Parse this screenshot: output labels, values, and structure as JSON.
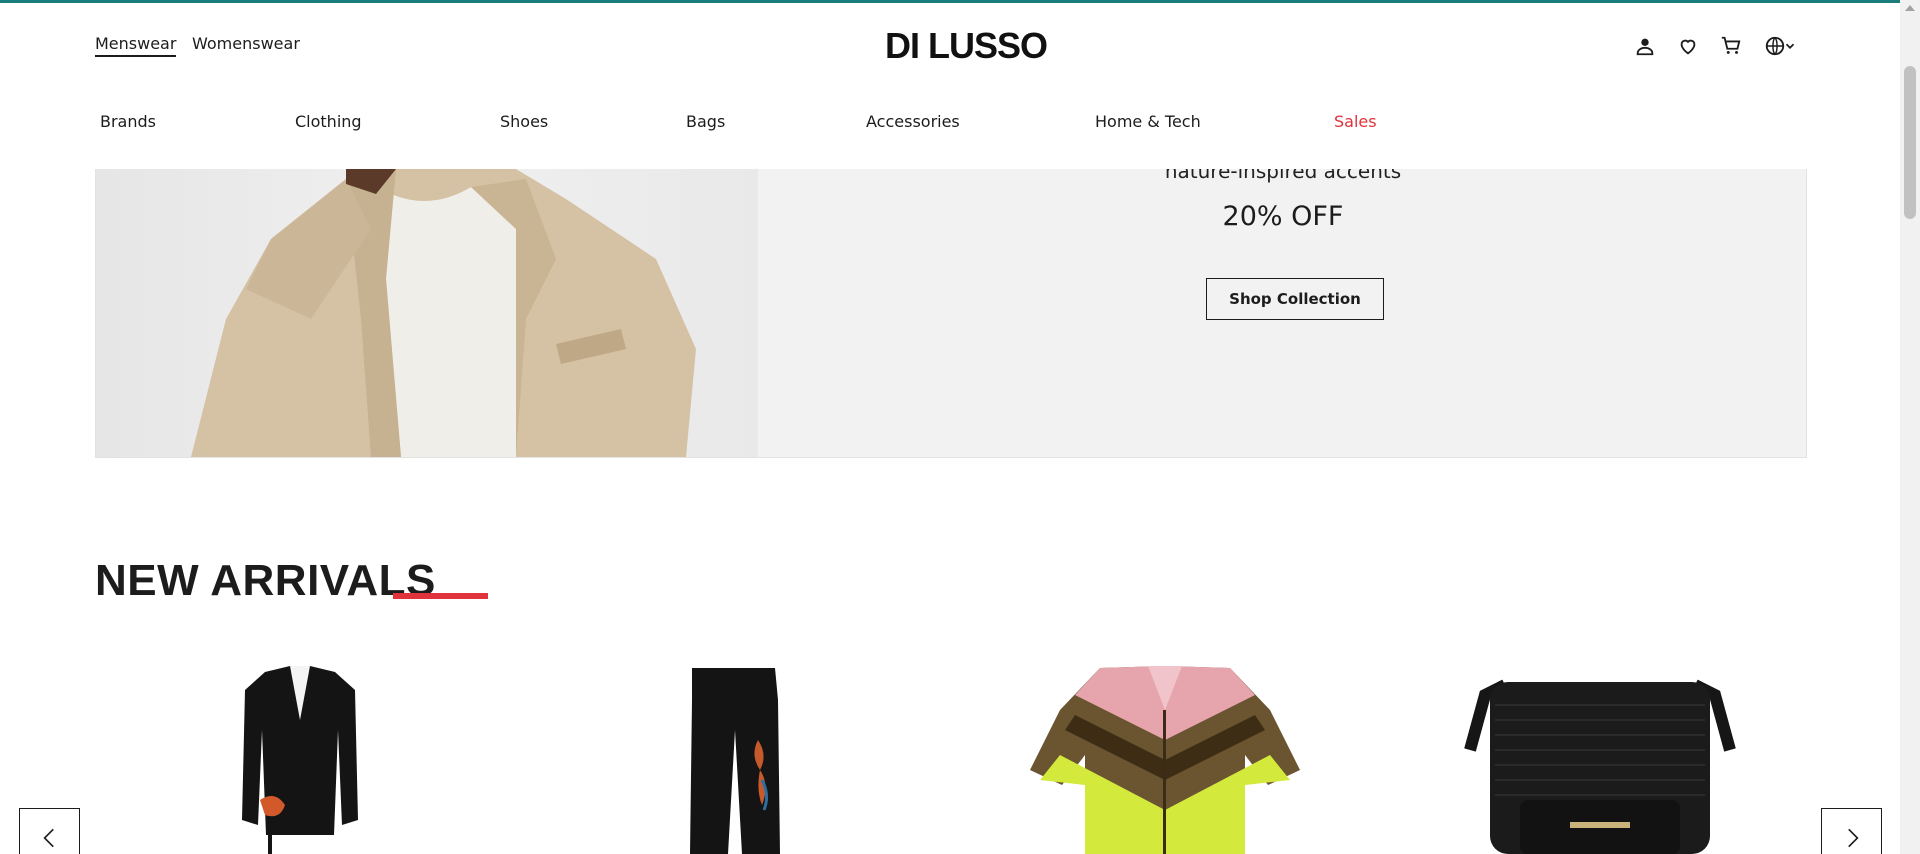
{
  "header": {
    "gender_tabs": [
      {
        "label": "Menswear",
        "active": true
      },
      {
        "label": "Womenswear",
        "active": false
      }
    ],
    "logo": "DI LUSSO",
    "icons": [
      "account-icon",
      "wishlist-heart-icon",
      "cart-icon",
      "globe-language-icon",
      "chevron-down-icon"
    ]
  },
  "nav": {
    "items": [
      {
        "label": "Brands"
      },
      {
        "label": "Clothing"
      },
      {
        "label": "Shoes"
      },
      {
        "label": "Bags"
      },
      {
        "label": "Accessories"
      },
      {
        "label": "Home & Tech"
      },
      {
        "label": "Sales",
        "color": "#e0333b"
      }
    ]
  },
  "hero": {
    "subtitle": "nature-inspired accents",
    "discount": "20% OFF",
    "cta_label": "Shop Collection"
  },
  "new_arrivals": {
    "title": "NEW ARRIVALS",
    "accent_color": "#e0333b",
    "products": [
      {
        "name": "black-blazer-image"
      },
      {
        "name": "black-trousers-image"
      },
      {
        "name": "striped-shirt-image"
      },
      {
        "name": "black-crossbody-bag-image"
      }
    ]
  },
  "colors": {
    "accent_top": "#1b7c7c",
    "sales_red": "#e0333b",
    "text": "#1c1c1c"
  }
}
